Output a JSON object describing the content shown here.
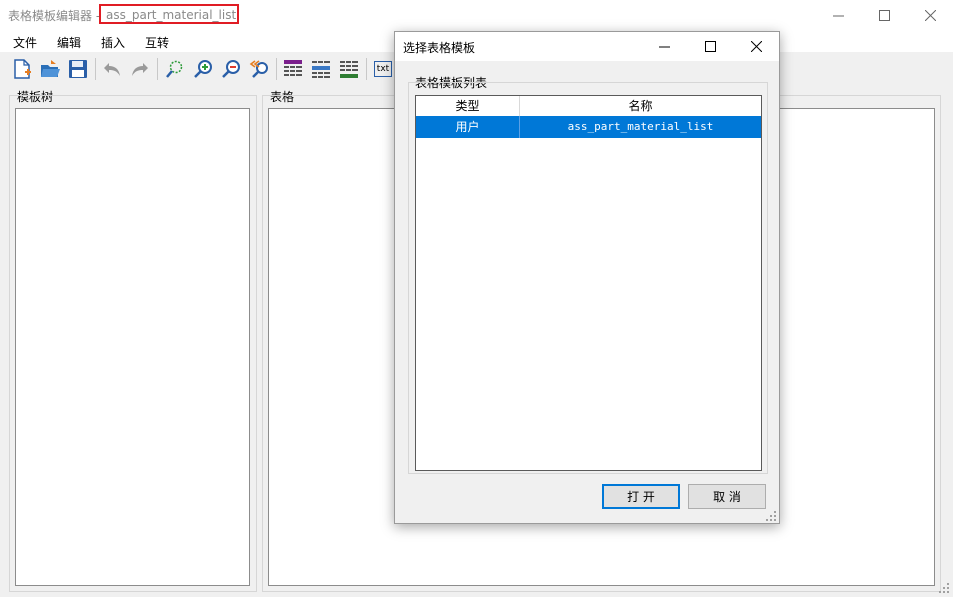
{
  "window": {
    "app_title": "表格模板编辑器",
    "separator": "-",
    "doc_title": "ass_part_material_list"
  },
  "menu": [
    {
      "label": "文件"
    },
    {
      "label": "编辑"
    },
    {
      "label": "插入"
    },
    {
      "label": "互转"
    }
  ],
  "toolbar": {
    "icons": [
      "new-file-icon",
      "open-folder-icon",
      "save-icon",
      "undo-icon",
      "redo-icon",
      "fit-view-icon",
      "zoom-in-icon",
      "zoom-out-icon",
      "zoom-reset-icon",
      "table-style-purple-icon",
      "table-style-blue-icon",
      "table-style-green-icon",
      "txt-icon"
    ],
    "txt_label": "txt"
  },
  "panels": {
    "tree_label": "模板树",
    "table_label": "表格"
  },
  "dialog": {
    "title": "选择表格模板",
    "group_label": "表格模板列表",
    "columns": [
      "类型",
      "名称"
    ],
    "rows": [
      {
        "type": "用户",
        "name": "ass_part_material_list"
      }
    ],
    "open_button": "打 开",
    "cancel_button": "取 消"
  },
  "colors": {
    "highlight": "#0078d7",
    "title_border": "#e01c24"
  }
}
